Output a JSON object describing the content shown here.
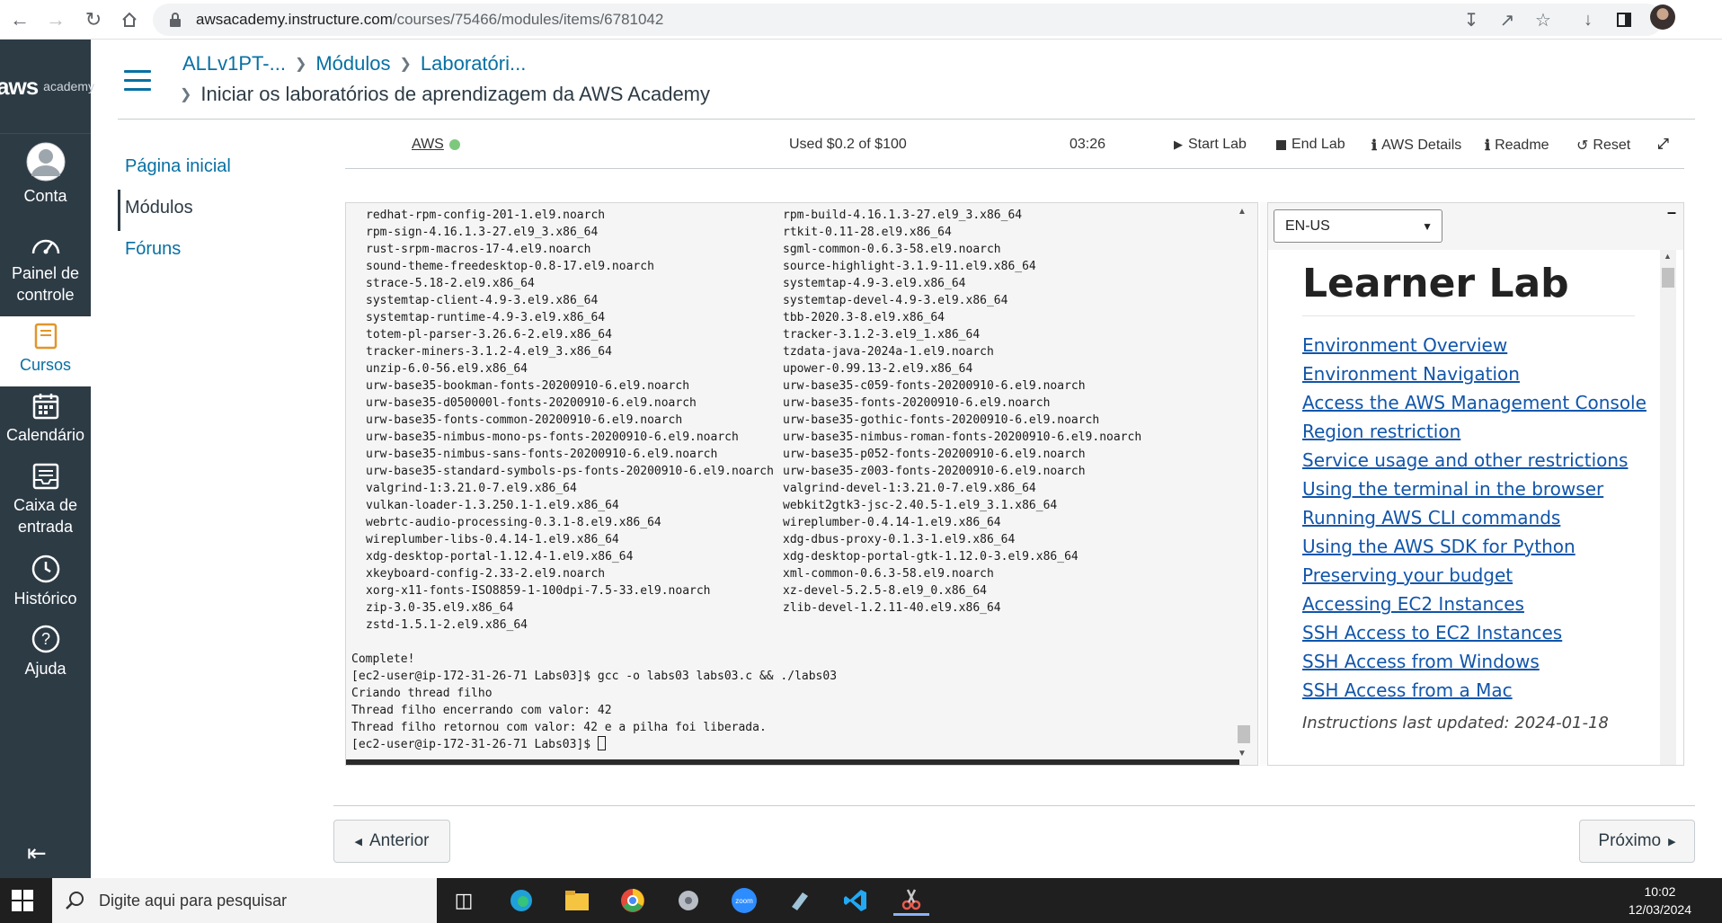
{
  "browser": {
    "url_host": "awsacademy.instructure.com",
    "url_path": "/courses/75466/modules/items/6781042"
  },
  "global_nav": {
    "logo_main": "aws",
    "logo_sub": "academy",
    "items": [
      {
        "label": "Conta",
        "icon": "user-avatar-icon"
      },
      {
        "label": "Painel de controle",
        "icon": "dashboard-gauge-icon"
      },
      {
        "label": "Cursos",
        "icon": "book-icon",
        "active": true
      },
      {
        "label": "Calendário",
        "icon": "calendar-icon"
      },
      {
        "label": "Caixa de entrada",
        "icon": "inbox-icon"
      },
      {
        "label": "Histórico",
        "icon": "clock-icon"
      },
      {
        "label": "Ajuda",
        "icon": "help-icon"
      }
    ]
  },
  "breadcrumbs": {
    "course": "ALLv1PT-...",
    "modules": "Módulos",
    "labs": "Laboratóri...",
    "current": "Iniciar os laboratórios de aprendizagem da AWS Academy"
  },
  "course_nav": {
    "home": "Página inicial",
    "modules": "Módulos",
    "forums": "Fóruns"
  },
  "lab_toolbar": {
    "aws_label": "AWS",
    "status_color": "#7ec87e",
    "budget": "Used $0.2 of $100",
    "timer": "03:26",
    "start": "Start Lab",
    "end": "End Lab",
    "details": "AWS Details",
    "readme": "Readme",
    "reset": "Reset"
  },
  "terminal": {
    "packages": [
      [
        "redhat-rpm-config-201-1.el9.noarch",
        "rpm-build-4.16.1.3-27.el9_3.x86_64"
      ],
      [
        "rpm-sign-4.16.1.3-27.el9_3.x86_64",
        "rtkit-0.11-28.el9.x86_64"
      ],
      [
        "rust-srpm-macros-17-4.el9.noarch",
        "sgml-common-0.6.3-58.el9.noarch"
      ],
      [
        "sound-theme-freedesktop-0.8-17.el9.noarch",
        "source-highlight-3.1.9-11.el9.x86_64"
      ],
      [
        "strace-5.18-2.el9.x86_64",
        "systemtap-4.9-3.el9.x86_64"
      ],
      [
        "systemtap-client-4.9-3.el9.x86_64",
        "systemtap-devel-4.9-3.el9.x86_64"
      ],
      [
        "systemtap-runtime-4.9-3.el9.x86_64",
        "tbb-2020.3-8.el9.x86_64"
      ],
      [
        "totem-pl-parser-3.26.6-2.el9.x86_64",
        "tracker-3.1.2-3.el9_1.x86_64"
      ],
      [
        "tracker-miners-3.1.2-4.el9_3.x86_64",
        "tzdata-java-2024a-1.el9.noarch"
      ],
      [
        "unzip-6.0-56.el9.x86_64",
        "upower-0.99.13-2.el9.x86_64"
      ],
      [
        "urw-base35-bookman-fonts-20200910-6.el9.noarch",
        "urw-base35-c059-fonts-20200910-6.el9.noarch"
      ],
      [
        "urw-base35-d050000l-fonts-20200910-6.el9.noarch",
        "urw-base35-fonts-20200910-6.el9.noarch"
      ],
      [
        "urw-base35-fonts-common-20200910-6.el9.noarch",
        "urw-base35-gothic-fonts-20200910-6.el9.noarch"
      ],
      [
        "urw-base35-nimbus-mono-ps-fonts-20200910-6.el9.noarch",
        "urw-base35-nimbus-roman-fonts-20200910-6.el9.noarch"
      ],
      [
        "urw-base35-nimbus-sans-fonts-20200910-6.el9.noarch",
        "urw-base35-p052-fonts-20200910-6.el9.noarch"
      ],
      [
        "urw-base35-standard-symbols-ps-fonts-20200910-6.el9.noarch",
        "urw-base35-z003-fonts-20200910-6.el9.noarch"
      ],
      [
        "valgrind-1:3.21.0-7.el9.x86_64",
        "valgrind-devel-1:3.21.0-7.el9.x86_64"
      ],
      [
        "vulkan-loader-1.3.250.1-1.el9.x86_64",
        "webkit2gtk3-jsc-2.40.5-1.el9_3.1.x86_64"
      ],
      [
        "webrtc-audio-processing-0.3.1-8.el9.x86_64",
        "wireplumber-0.4.14-1.el9.x86_64"
      ],
      [
        "wireplumber-libs-0.4.14-1.el9.x86_64",
        "xdg-dbus-proxy-0.1.3-1.el9.x86_64"
      ],
      [
        "xdg-desktop-portal-1.12.4-1.el9.x86_64",
        "xdg-desktop-portal-gtk-1.12.0-3.el9.x86_64"
      ],
      [
        "xkeyboard-config-2.33-2.el9.noarch",
        "xml-common-0.6.3-58.el9.noarch"
      ],
      [
        "xorg-x11-fonts-ISO8859-1-100dpi-7.5-33.el9.noarch",
        "xz-devel-5.2.5-8.el9_0.x86_64"
      ],
      [
        "zip-3.0-35.el9.x86_64",
        "zlib-devel-1.2.11-40.el9.x86_64"
      ],
      [
        "zstd-1.5.1-2.el9.x86_64",
        ""
      ]
    ],
    "output": [
      "Complete!",
      "[ec2-user@ip-172-31-26-71 Labs03]$ gcc -o labs03 labs03.c && ./labs03",
      "Criando thread filho",
      "Thread filho encerrando com valor: 42",
      "Thread filho retornou com valor: 42 e a pilha foi liberada."
    ],
    "prompt": "[ec2-user@ip-172-31-26-71 Labs03]$ "
  },
  "readme": {
    "language": "EN-US",
    "title": "Learner Lab",
    "links": [
      "Environment Overview",
      "Environment Navigation ",
      "Access the AWS Management Console ",
      "Region restriction ",
      "Service usage and other restrictions ",
      "Using the terminal in the browser ",
      "Running AWS CLI commands ",
      "Using the AWS SDK for Python ",
      "Preserving your budget ",
      "Accessing EC2 Instances ",
      "SSH Access to EC2 Instances ",
      "SSH Access from Windows",
      "SSH Access from a Mac"
    ],
    "footer": "Instructions last updated: 2024-01-18"
  },
  "pager": {
    "previous": "Anterior",
    "next": "Próximo"
  },
  "taskbar": {
    "search_placeholder": "Digite aqui para pesquisar",
    "time": "10:02",
    "date": "12/03/2024"
  }
}
